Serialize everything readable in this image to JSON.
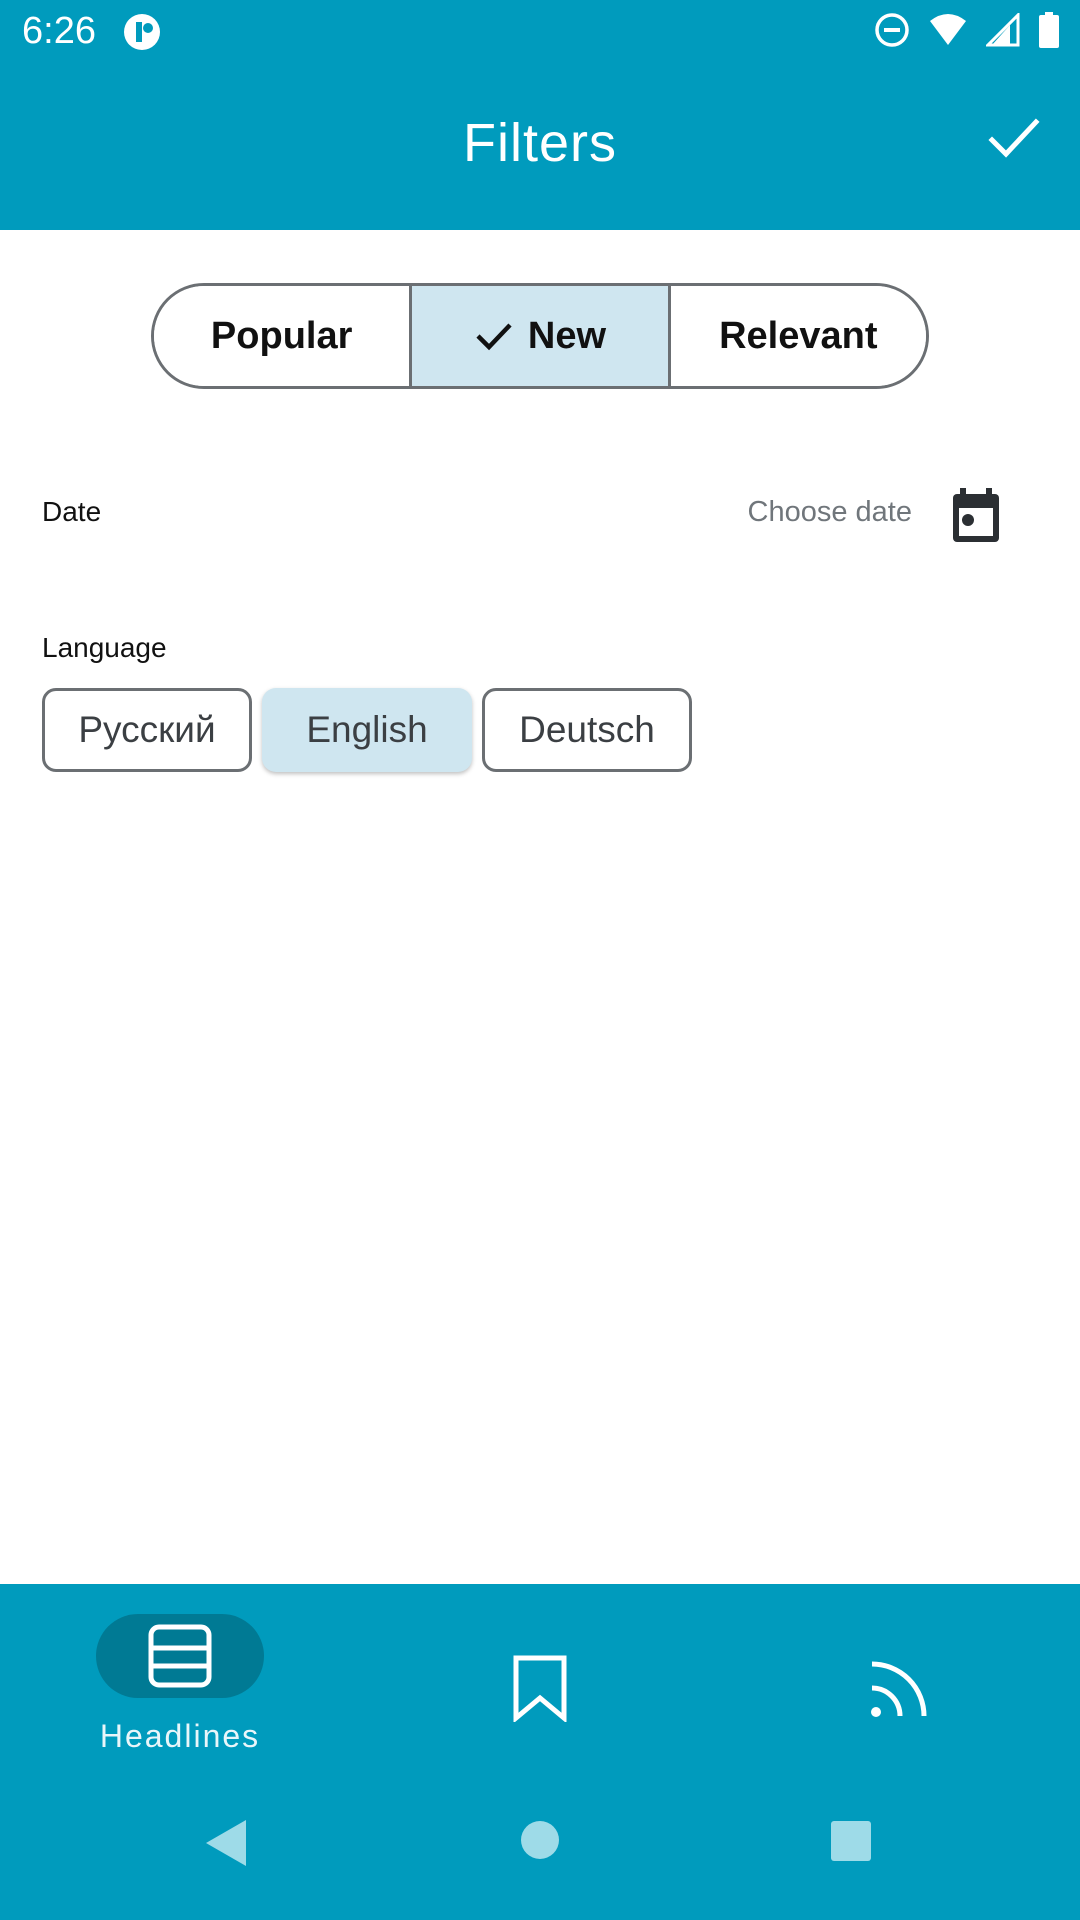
{
  "status_bar": {
    "time": "6:26",
    "icons": [
      "app-notification-icon",
      "do-not-disturb-icon",
      "wifi-icon",
      "cell-signal-icon",
      "battery-icon"
    ]
  },
  "app_bar": {
    "title": "Filters",
    "action_icon": "check-icon"
  },
  "sort": {
    "options": [
      {
        "label": "Popular",
        "selected": false
      },
      {
        "label": "New",
        "selected": true
      },
      {
        "label": "Relevant",
        "selected": false
      }
    ]
  },
  "date": {
    "label": "Date",
    "value": "Choose date",
    "icon": "calendar-icon"
  },
  "language": {
    "label": "Language",
    "chips": [
      {
        "label": "Русский",
        "selected": false
      },
      {
        "label": "English",
        "selected": true
      },
      {
        "label": "Deutsch",
        "selected": false
      }
    ]
  },
  "bottom_nav": {
    "items": [
      {
        "label": "Headlines",
        "icon": "headlines-icon",
        "active": true
      },
      {
        "label": "",
        "icon": "bookmark-icon",
        "active": false
      },
      {
        "label": "",
        "icon": "rss-feed-icon",
        "active": false
      }
    ]
  },
  "system_nav": [
    "back-icon",
    "home-icon",
    "recents-icon"
  ],
  "colors": {
    "primary": "#009bbd",
    "selected_bg": "#cfe6f0",
    "active_pill": "#007a94",
    "outline": "#6b6f73"
  }
}
